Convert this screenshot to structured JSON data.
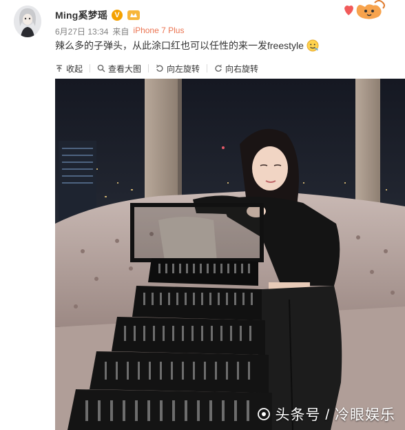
{
  "post": {
    "username": "Ming奚梦瑶",
    "verified_badge": "V",
    "date": "6月27日 13:34",
    "source_prefix": "来自",
    "source": "iPhone 7 Plus",
    "text": "辣么多的子弹头，从此涂口红也可以任性的来一发freestyle"
  },
  "toolbar": {
    "collapse_label": "收起",
    "view_large_label": "查看大图",
    "rotate_left_label": "向左旋转",
    "rotate_right_label": "向右旋转"
  },
  "watermark": {
    "text": "头条号 / 冷眼娱乐"
  },
  "colors": {
    "source_link": "#eb7350",
    "badge": "#f4a100",
    "meta_text": "#808080"
  },
  "icons": [
    "avatar",
    "verified-badge-icon",
    "member-icon",
    "mascot-icon",
    "emoji-icon",
    "collapse-icon",
    "zoom-icon",
    "rotate-left-icon",
    "rotate-right-icon",
    "watermark-logo-icon"
  ]
}
